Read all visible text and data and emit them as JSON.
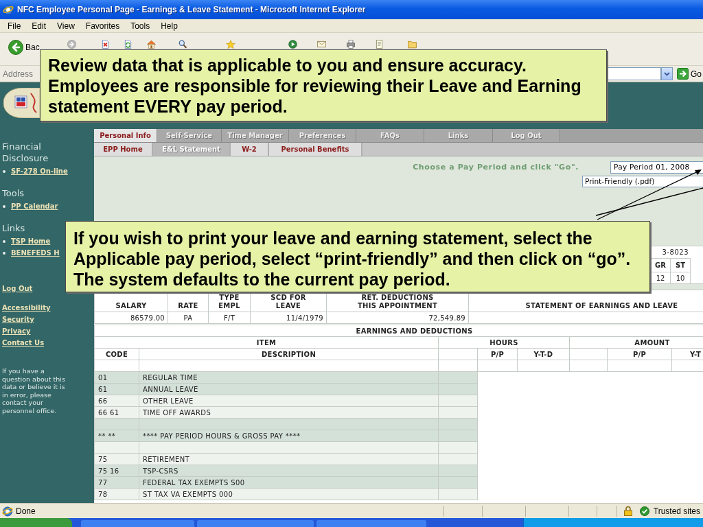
{
  "window": {
    "title": "NFC Employee Personal Page - Earnings & Leave Statement - Microsoft Internet Explorer"
  },
  "menu_bar": [
    "File",
    "Edit",
    "View",
    "Favorites",
    "Tools",
    "Help"
  ],
  "toolbar": {
    "back_label": "Bac"
  },
  "address_bar": {
    "label": "Address",
    "go_label": "Go"
  },
  "sidebar": {
    "sections": [
      {
        "heading": "Financial Disclosure",
        "links": [
          "SF-278 On-line"
        ]
      },
      {
        "heading": "Tools",
        "links": [
          "PP Calendar"
        ]
      },
      {
        "heading": "Links",
        "links": [
          "TSP Home",
          "BENEFEDS H"
        ]
      }
    ],
    "log_out": "Log Out",
    "footer_links": [
      "Accessibility",
      "Security",
      "Privacy",
      "Contact Us"
    ],
    "note": "If you have a question about this data or believe it is in error, please contact your personnel office."
  },
  "main_tabs": [
    {
      "label": "Personal Info",
      "selected": true
    },
    {
      "label": "Self-Service",
      "selected": false
    },
    {
      "label": "Time Manager",
      "selected": false
    },
    {
      "label": "Preferences",
      "selected": false
    },
    {
      "label": "FAQs",
      "selected": false
    },
    {
      "label": "Links",
      "selected": false
    },
    {
      "label": "Log Out",
      "selected": false
    }
  ],
  "sub_tabs": [
    {
      "label": "EPP Home",
      "selected": false
    },
    {
      "label": "E&L Statement",
      "selected": true
    },
    {
      "label": "W-2",
      "selected": false
    },
    {
      "label": "Personal Benefits",
      "selected": false
    }
  ],
  "pay_period_panel": {
    "prompt": "Choose a Pay Period and click \"Go\".",
    "period_select": {
      "value": "Pay Period 01, 2008"
    },
    "format_select": {
      "value": "Print-Friendly (.pdf)"
    }
  },
  "info_table": {
    "top_cell": "3-8023",
    "columns": [
      "GR",
      "ST"
    ],
    "values": [
      "12",
      "10"
    ]
  },
  "summary_table": {
    "columns": [
      "SALARY",
      "RATE",
      "TYPE\nEMPL",
      "SCD FOR\nLEAVE",
      "RET. DEDUCTIONS\nTHIS APPOINTMENT",
      "STATEMENT OF EARNINGS AND LEAVE"
    ],
    "values": [
      "86579.00",
      "PA",
      "F/T",
      "11/4/1979",
      "72,549.89"
    ]
  },
  "earnings_table": {
    "title": "EARNINGS AND DEDUCTIONS",
    "column_groups": [
      {
        "label": "ITEM",
        "columns": [
          "CODE",
          "DESCRIPTION"
        ]
      },
      {
        "label": "HOURS",
        "columns": [
          "P/P",
          "Y-T-D"
        ]
      },
      {
        "label": "AMOUNT",
        "columns": [
          "P/P",
          "Y-T"
        ]
      }
    ],
    "rows": [
      {
        "code": "01",
        "description": "REGULAR TIME",
        "shaded": true
      },
      {
        "code": "61",
        "description": "ANNUAL LEAVE",
        "shaded": true
      },
      {
        "code": "66",
        "description": "OTHER LEAVE",
        "shaded": false
      },
      {
        "code": "66 61",
        "description": "TIME OFF AWARDS",
        "shaded": false
      },
      {
        "shaded": true
      },
      {
        "code": "** **",
        "description": "**** PAY PERIOD HOURS & GROSS PAY ****",
        "shaded": true
      },
      {
        "shaded": false
      },
      {
        "code": "75",
        "description": "RETIREMENT",
        "shaded": false
      },
      {
        "code": "75 16",
        "description": "TSP-CSRS",
        "shaded": true
      },
      {
        "code": "77",
        "description": "FEDERAL TAX EXEMPTS S00",
        "shaded": true
      },
      {
        "code": "78",
        "description": "ST TAX VA EXEMPTS 000",
        "shaded": false
      }
    ]
  },
  "callouts": [
    {
      "text": "Review data that is applicable to you and ensure accuracy. Employees are responsible for reviewing their Leave and Earning statement EVERY pay period."
    },
    {
      "text": "If you wish to print your leave and earning statement, select the Applicable pay period, select “print-friendly” and then click on “go”. The system defaults to the current pay period."
    }
  ],
  "status_bar": {
    "text": "Done",
    "zone": "Trusted sites"
  }
}
